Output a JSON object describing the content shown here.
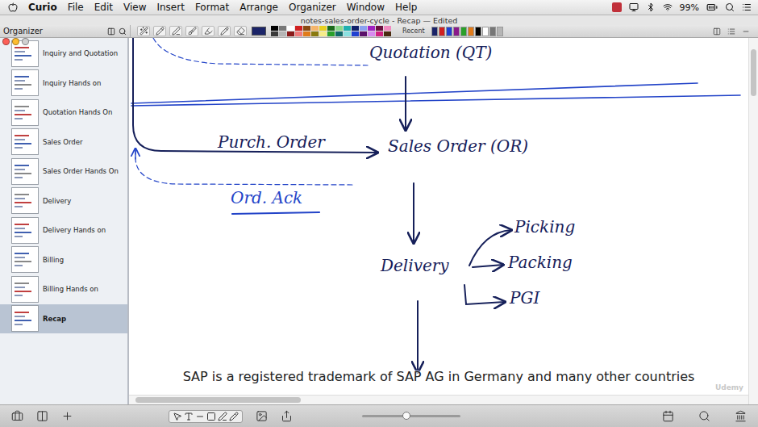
{
  "menu_bar": {
    "app": "Curio",
    "items": [
      "File",
      "Edit",
      "View",
      "Insert",
      "Format",
      "Arrange",
      "Organizer",
      "Window",
      "Help"
    ],
    "battery": "99%"
  },
  "window": {
    "title": "notes-sales-order-cycle - Recap — Edited"
  },
  "toolbar": {
    "organizer_label": "Organizer",
    "recent_label": "Recent",
    "palette": [
      "#000000",
      "#3a3a3a",
      "#777777",
      "#b5b5b5",
      "#ffffff",
      "#8b1a1a",
      "#d02020",
      "#f07a7a",
      "#8a4a10",
      "#e07b1a",
      "#f5b56a",
      "#8a7a10",
      "#e8d020",
      "#f5ec8a",
      "#1a6a1a",
      "#2aa02a",
      "#8ad88a",
      "#106a6a",
      "#20b0b0",
      "#8ae0e0",
      "#10206a",
      "#2040d0",
      "#8aa0f0",
      "#5a106a",
      "#a020c0",
      "#d88af0",
      "#6a1040",
      "#d02080",
      "#f08ac0",
      "#4a2a10"
    ],
    "recent_colors": [
      "#1b2468",
      "#d02020",
      "#2040d0",
      "#8a1a8a",
      "#2aa02a",
      "#e07b1a",
      "#000000",
      "#ffffff",
      "#777777",
      "#b5b5b5"
    ]
  },
  "sidebar": {
    "items": [
      {
        "label": "Inquiry and Quotation",
        "selected": false
      },
      {
        "label": "Inquiry Hands on",
        "selected": false
      },
      {
        "label": "Quotation Hands On",
        "selected": false
      },
      {
        "label": "Sales Order",
        "selected": false
      },
      {
        "label": "Sales Order Hands On",
        "selected": false
      },
      {
        "label": "Delivery",
        "selected": false
      },
      {
        "label": "Delivery Hands on",
        "selected": false
      },
      {
        "label": "Billing",
        "selected": false
      },
      {
        "label": "Billing Hands on",
        "selected": false
      },
      {
        "label": "Recap",
        "selected": true
      }
    ]
  },
  "diagram": {
    "quotation": "Quotation (QT)",
    "sales_order": "Sales Order (OR)",
    "purchase_order": "Purch. Order",
    "acknowledgement": "Ord. Ack",
    "delivery": "Delivery",
    "steps": [
      "Picking",
      "Packing",
      "PGI"
    ]
  },
  "caption": "SAP is a registered trademark of SAP AG in Germany and many other countries",
  "watermark": "Udemy",
  "zoom": {
    "level": 0.45
  }
}
